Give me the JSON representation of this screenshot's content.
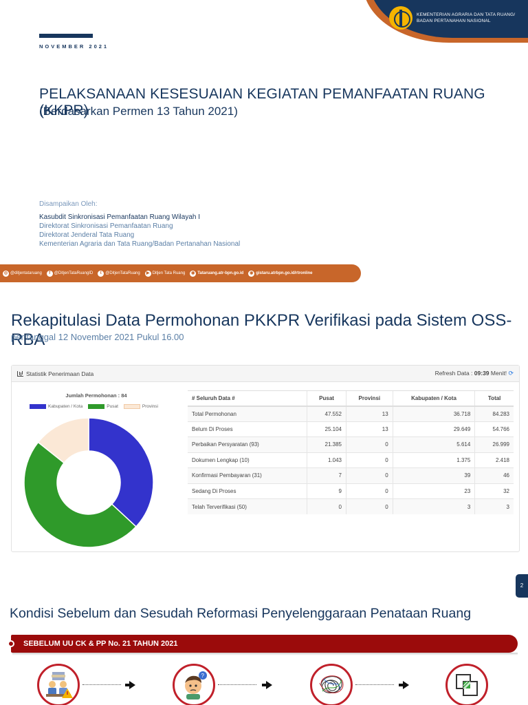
{
  "slide1": {
    "logo_text_line1": "KEMENTERIAN AGRARIA DAN TATA RUANG/",
    "logo_text_line2": "BADAN PERTANAHAN NASIONAL",
    "date": "NOVEMBER 2021",
    "title": "PELAKSANAAN KESESUAIAN KEGIATAN PEMANFAATAN RUANG (KKPR)",
    "subtitle": "(Berdasarkan Permen 13 Tahun 2021)",
    "presenter_label": "Disampaikan Oleh:",
    "presenter_lines": [
      "Kasubdit Sinkronisasi Pemanfaatan Ruang Wilayah I",
      "Direktorat Sinkronisasi Pemanfaatan Ruang",
      "Direktorat Jenderal Tata Ruang",
      "Kementerian Agraria dan Tata Ruang/Badan Pertanahan Nasional"
    ],
    "social": [
      {
        "icon": "instagram-icon",
        "glyph": "◎",
        "text": "@ditjentataruang"
      },
      {
        "icon": "facebook-icon",
        "glyph": "f",
        "text": "@DitjenTataRuangID"
      },
      {
        "icon": "twitter-icon",
        "glyph": "t",
        "text": "@DitjenTataRuang"
      },
      {
        "icon": "youtube-icon",
        "glyph": "▶",
        "text": "Ditjen Tata Ruang"
      },
      {
        "icon": "web-icon",
        "glyph": "◉",
        "text": "Tataruang.atr-bpn.go.id"
      },
      {
        "icon": "web-icon",
        "glyph": "◉",
        "text": "gistaru.atrbpn.go.id/rtronline"
      }
    ]
  },
  "slide2": {
    "title": "Rekapitulasi Data Permohonan PKKPR Verifikasi pada Sistem OSS-RBA",
    "subtitle": "per tanggal 12 November 2021 Pukul 16.00",
    "panel_title": "Statistik Penerimaan Data",
    "refresh_label": "Refresh Data :",
    "refresh_value": "09:39",
    "refresh_unit": "Menit!",
    "table": {
      "headers": [
        "# Seluruh Data #",
        "Pusat",
        "Provinsi",
        "Kabupaten / Kota",
        "Total"
      ],
      "rows": [
        [
          "Total Permohonan",
          "47.552",
          "13",
          "36.718",
          "84.283"
        ],
        [
          "Belum Di Proses",
          "25.104",
          "13",
          "29.649",
          "54.766"
        ],
        [
          "Perbaikan Persyaratan (93)",
          "21.385",
          "0",
          "5.614",
          "26.999"
        ],
        [
          "Dokumen Lengkap (10)",
          "1.043",
          "0",
          "1.375",
          "2.418"
        ],
        [
          "Konfirmasi Pembayaran (31)",
          "7",
          "0",
          "39",
          "46"
        ],
        [
          "Sedang Di Proses",
          "9",
          "0",
          "23",
          "32"
        ],
        [
          "Telah Terverifikasi (50)",
          "0",
          "0",
          "3",
          "3"
        ]
      ]
    },
    "page_number": "2"
  },
  "chart_data": {
    "type": "pie",
    "title": "Jumlah Permohonan : 84",
    "series": [
      {
        "name": "Kabupaten / Kota",
        "value": 31,
        "color": "#3333cc"
      },
      {
        "name": "Pusat",
        "value": 41,
        "color": "#2f9a2a"
      },
      {
        "name": "Provinsi",
        "value": 12,
        "color": "#fbe8d6"
      }
    ],
    "legend_position": "top",
    "donut": true
  },
  "slide3": {
    "title": "Kondisi Sebelum dan Sesudah Reformasi Penyelenggaraan Penataan Ruang",
    "banner": "SEBELUM UU CK & PP No. 21 TAHUN 2021",
    "steps": [
      {
        "icon": "workers-paperwork-icon"
      },
      {
        "icon": "confused-person-icon"
      },
      {
        "icon": "tangled-scribble-icon"
      },
      {
        "icon": "overlapping-squares-icon"
      }
    ]
  }
}
